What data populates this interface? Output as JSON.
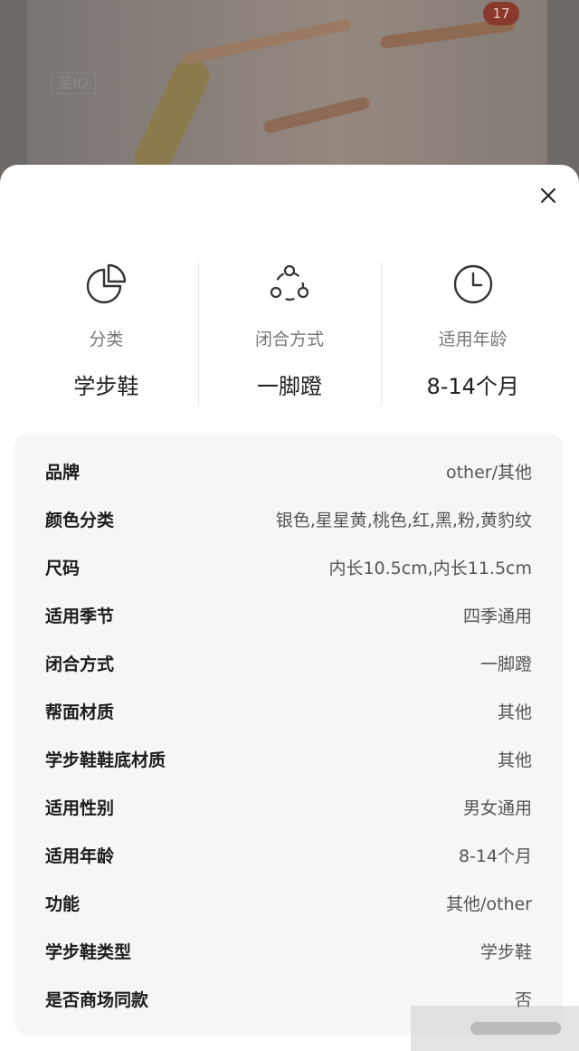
{
  "backdrop": {
    "image_count": "17",
    "ghost_label": "至IQ"
  },
  "summary": [
    {
      "icon": "pie-chart-icon",
      "label": "分类",
      "value": "学步鞋"
    },
    {
      "icon": "closure-circle-icon",
      "label": "闭合方式",
      "value": "一脚蹬"
    },
    {
      "icon": "clock-icon",
      "label": "适用年龄",
      "value": "8-14个月"
    }
  ],
  "details": [
    {
      "key": "品牌",
      "value": "other/其他"
    },
    {
      "key": "颜色分类",
      "value": "银色,星星黄,桃色,红,黑,粉,黄豹纹"
    },
    {
      "key": "尺码",
      "value": "内长10.5cm,内长11.5cm"
    },
    {
      "key": "适用季节",
      "value": "四季通用"
    },
    {
      "key": "闭合方式",
      "value": "一脚蹬"
    },
    {
      "key": "帮面材质",
      "value": "其他"
    },
    {
      "key": "学步鞋鞋底材质",
      "value": "其他"
    },
    {
      "key": "适用性别",
      "value": "男女通用"
    },
    {
      "key": "适用年龄",
      "value": "8-14个月"
    },
    {
      "key": "功能",
      "value": "其他/other"
    },
    {
      "key": "学步鞋类型",
      "value": "学步鞋"
    },
    {
      "key": "是否商场同款",
      "value": "否"
    }
  ]
}
